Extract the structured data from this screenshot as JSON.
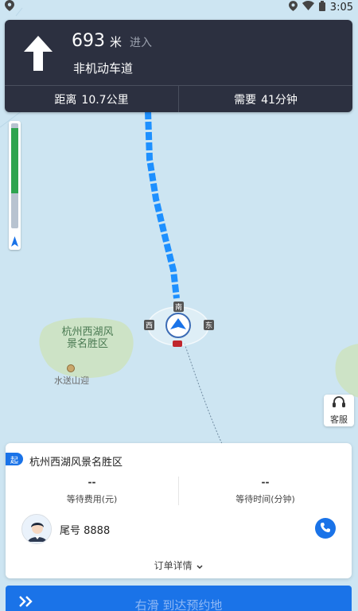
{
  "status": {
    "time": "3:05"
  },
  "nav": {
    "distance_value": "693",
    "distance_unit": "米",
    "action": "进入",
    "road": "非机动车道",
    "remaining_distance_label": "距离",
    "remaining_distance_value": "10.7公里",
    "remaining_time_label": "需要",
    "remaining_time_value": "41分钟"
  },
  "traffic": {
    "progress": 0.62,
    "color_good": "#2ea44f",
    "color_rest": "#b8c3d0"
  },
  "map": {
    "poi_name_line1": "杭州西湖风",
    "poi_name_line2": "景名胜区",
    "poi_sub": "水送山迎",
    "compass": {
      "south": "南",
      "west": "西",
      "east": "东"
    }
  },
  "service": {
    "label": "客服"
  },
  "order": {
    "start_tag": "起",
    "start_name": "杭州西湖风景名胜区",
    "wait_fee_value": "--",
    "wait_fee_label": "等待费用(元)",
    "wait_time_value": "--",
    "wait_time_label": "等待时间(分钟)",
    "tail_number": "尾号 8888",
    "details_label": "订单详情"
  },
  "slide": {
    "label": "右滑 到达预约地"
  },
  "colors": {
    "accent": "#1a73e8",
    "nav_bg": "#2c3040",
    "route": "#1e90ff"
  }
}
